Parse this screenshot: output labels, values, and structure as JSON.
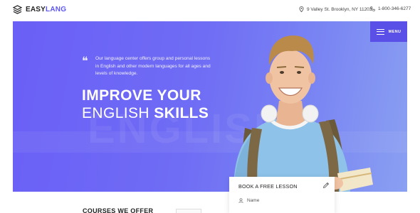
{
  "brand": {
    "name_part1": "EASY",
    "name_part2": "LANG",
    "accent_color": "#5d56f1"
  },
  "contact": {
    "address": "9 Valley St. Brooklyn, NY 11203",
    "address_icon": "location-pin-icon",
    "phone": "1-800-346-6277",
    "phone_icon": "phone-icon"
  },
  "menu": {
    "label": "MENU",
    "icon": "hamburger-icon"
  },
  "hero": {
    "quote": "Our language center offers group and personal lessons in English and other modern languages for all ages and levels of knowledge.",
    "headline_line1": "IMPROVE YOUR",
    "headline_line2_regular": "ENGLISH",
    "headline_line2_bold": "SKILLS",
    "background_word": "ENGLISH",
    "gradient_start": "#6a5ff6",
    "gradient_end": "#8aa0f2"
  },
  "booking": {
    "title": "BOOK A FREE LESSON",
    "title_icon": "pencil-icon",
    "name_placeholder": "Name",
    "name_icon": "user-icon"
  },
  "sections": {
    "courses_heading": "COURSES WE OFFER"
  }
}
